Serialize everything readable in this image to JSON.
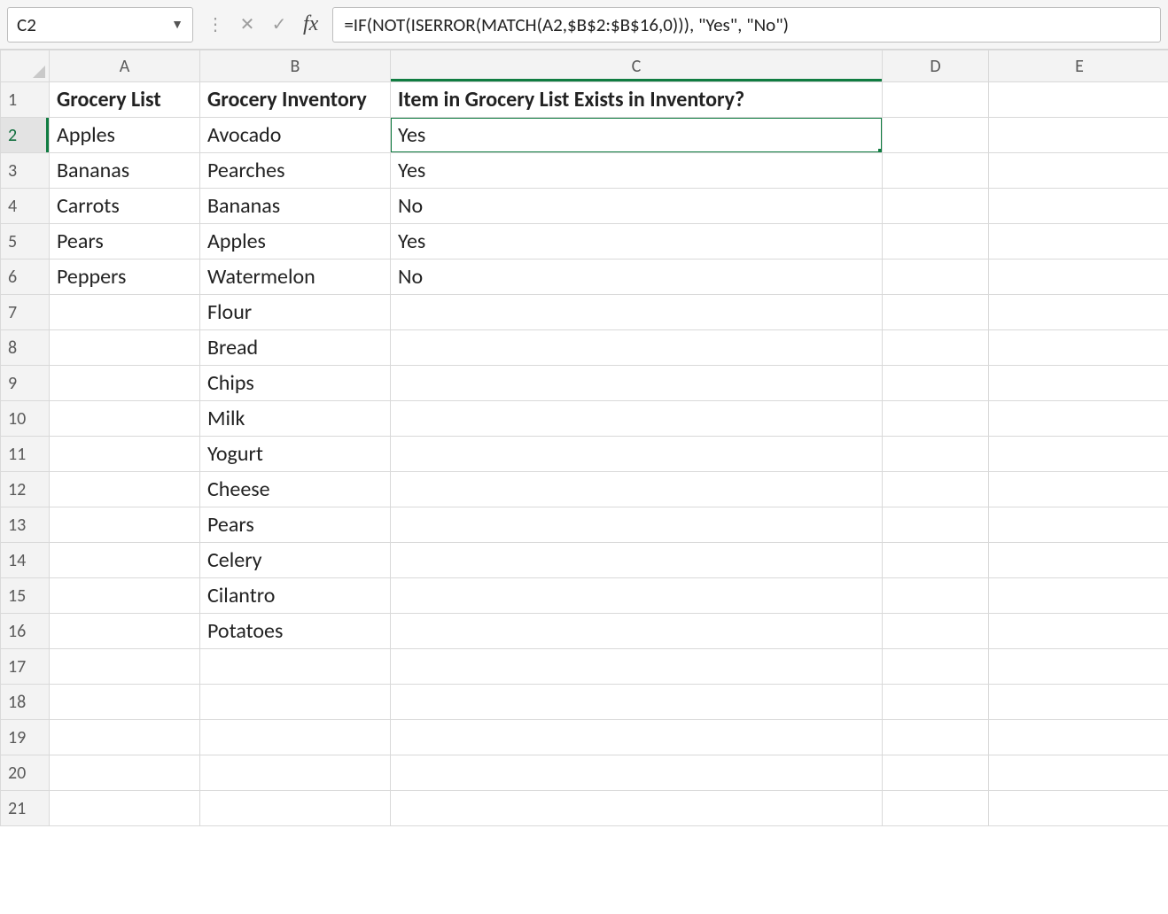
{
  "formula_bar": {
    "name_box_value": "C2",
    "fx_label": "fx",
    "formula_value": "=IF(NOT(ISERROR(MATCH(A2,$B$2:$B$16,0))), \"Yes\", \"No\")"
  },
  "columns": {
    "A": "A",
    "B": "B",
    "C": "C",
    "D": "D",
    "E": "E"
  },
  "row_count": 21,
  "active_cell": "C2",
  "headers": {
    "A": "Grocery List",
    "B": "Grocery Inventory",
    "C": "Item in Grocery List Exists in Inventory?"
  },
  "cells": {
    "1": {
      "A": "Grocery List",
      "B": "Grocery Inventory",
      "C": "Item in Grocery List Exists in Inventory?"
    },
    "2": {
      "A": "Apples",
      "B": "Avocado",
      "C": "Yes"
    },
    "3": {
      "A": "Bananas",
      "B": "Pearches",
      "C": "Yes"
    },
    "4": {
      "A": "Carrots",
      "B": "Bananas",
      "C": "No"
    },
    "5": {
      "A": "Pears",
      "B": "Apples",
      "C": "Yes"
    },
    "6": {
      "A": "Peppers",
      "B": "Watermelon",
      "C": "No"
    },
    "7": {
      "B": "Flour"
    },
    "8": {
      "B": "Bread"
    },
    "9": {
      "B": "Chips"
    },
    "10": {
      "B": "Milk"
    },
    "11": {
      "B": "Yogurt"
    },
    "12": {
      "B": "Cheese"
    },
    "13": {
      "B": "Pears"
    },
    "14": {
      "B": "Celery"
    },
    "15": {
      "B": "Cilantro"
    },
    "16": {
      "B": "Potatoes"
    }
  }
}
